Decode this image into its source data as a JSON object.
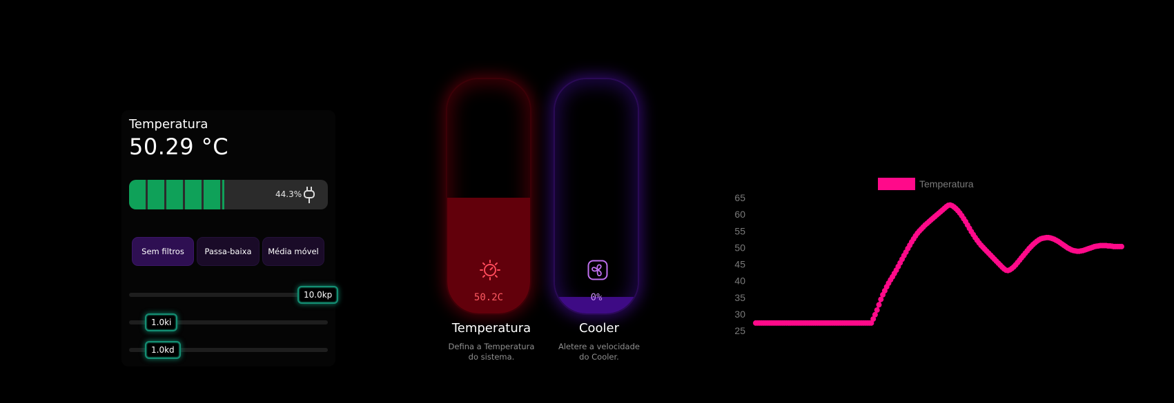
{
  "controls": {
    "temp_label": "Temperatura",
    "temp_value": "50.29 °C",
    "battery": {
      "percent_label": "44.3%",
      "level": 0.443,
      "cells": 5,
      "color": "#0fa159"
    },
    "filters": [
      {
        "label": "Sem filtros",
        "active": true
      },
      {
        "label": "Passa-baixa",
        "active": false
      },
      {
        "label": "Média móvel",
        "active": false
      }
    ],
    "sliders": [
      {
        "name": "kp",
        "label": "10.0kp",
        "value": 10.0
      },
      {
        "name": "ki",
        "label": "1.0ki",
        "value": 1.0
      },
      {
        "name": "kd",
        "label": "1.0kd",
        "value": 1.0
      }
    ]
  },
  "gauges": {
    "temperature": {
      "value_label": "50.2C",
      "fill_level": 0.495,
      "icon": "sun-gauge-icon",
      "title": "Temperatura",
      "description_line1": "Defina a Temperatura",
      "description_line2": "do sistema.",
      "color": "#ff5a63"
    },
    "cooler": {
      "value_label": "0%",
      "fill_level": 0.07,
      "icon": "fan-icon",
      "title": "Cooler",
      "description_line1": "Aletere a velocidade",
      "description_line2": "do Cooler.",
      "color": "#c88ff2"
    }
  },
  "chart_data": {
    "type": "line",
    "legend": "Temperatura",
    "legend_position": "top",
    "color": "#ff0a8a",
    "grid": false,
    "ylim": [
      25,
      65
    ],
    "yticks": [
      25,
      30,
      35,
      40,
      45,
      50,
      55,
      60,
      65
    ],
    "values": [
      27.3,
      27.3,
      27.3,
      27.3,
      27.3,
      27.3,
      27.3,
      27.3,
      27.3,
      27.3,
      27.3,
      27.3,
      27.3,
      27.3,
      27.3,
      27.3,
      27.3,
      27.3,
      27.3,
      27.3,
      27.3,
      27.3,
      27.3,
      27.3,
      27.3,
      27.3,
      27.3,
      27.3,
      27.3,
      27.3,
      27.3,
      27.3,
      27.3,
      27.3,
      27.3,
      27.3,
      27.3,
      27.3,
      27.3,
      27.3,
      27.3,
      27.3,
      27.3,
      27.3,
      27.3,
      27.3,
      27.3,
      27.3,
      27.3,
      27.3,
      27.3,
      27.3,
      27.3,
      27.3,
      27.3,
      27.3,
      27.3,
      27.3,
      27.3,
      27.3,
      27.3,
      28.5,
      29.8,
      31.2,
      32.8,
      34.4,
      35.8,
      37.0,
      38.2,
      39.3,
      40.3,
      41.2,
      42.2,
      43.2,
      44.3,
      45.4,
      46.5,
      47.6,
      48.6,
      49.7,
      50.7,
      51.7,
      52.6,
      53.5,
      54.3,
      55.0,
      55.6,
      56.2,
      56.8,
      57.3,
      57.8,
      58.3,
      58.8,
      59.3,
      59.8,
      60.3,
      60.8,
      61.3,
      61.8,
      62.3,
      62.7,
      62.8,
      62.6,
      62.2,
      61.7,
      61.1,
      60.4,
      59.6,
      58.7,
      57.8,
      56.8,
      55.8,
      54.8,
      53.9,
      53.0,
      52.2,
      51.4,
      50.7,
      50.1,
      49.5,
      48.9,
      48.3,
      47.7,
      47.1,
      46.5,
      45.9,
      45.3,
      44.7,
      44.1,
      43.6,
      43.2,
      43.1,
      43.3,
      43.7,
      44.2,
      44.8,
      45.5,
      46.2,
      46.9,
      47.6,
      48.3,
      49.0,
      49.7,
      50.3,
      50.9,
      51.4,
      51.9,
      52.3,
      52.6,
      52.8,
      52.9,
      53.0,
      53.0,
      52.9,
      52.7,
      52.5,
      52.2,
      51.9,
      51.5,
      51.1,
      50.7,
      50.3,
      49.9,
      49.6,
      49.3,
      49.1,
      49.0,
      48.9,
      48.9,
      49.0,
      49.1,
      49.3,
      49.5,
      49.7,
      49.9,
      50.1,
      50.3,
      50.4,
      50.5,
      50.6,
      50.6,
      50.6,
      50.6,
      50.5,
      50.5,
      50.4,
      50.3,
      50.3,
      50.3,
      50.3,
      50.3
    ]
  }
}
